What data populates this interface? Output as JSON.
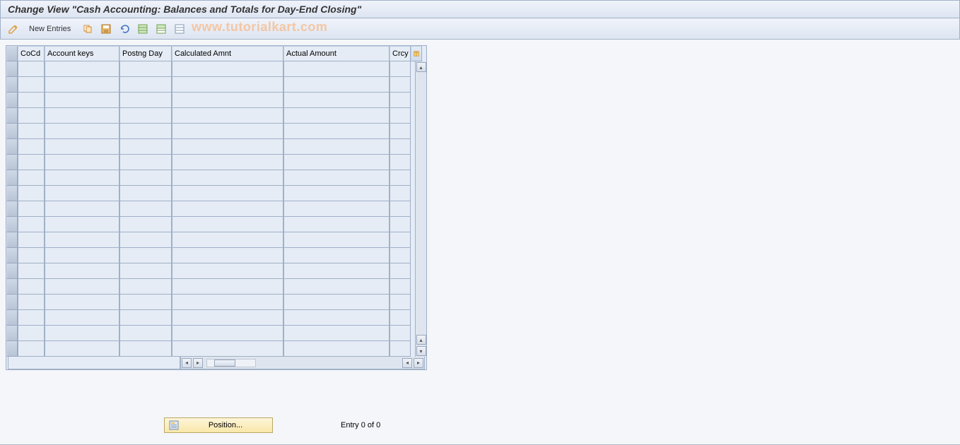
{
  "title": "Change View \"Cash Accounting: Balances and Totals for Day-End Closing\"",
  "toolbar": {
    "new_entries_label": "New Entries"
  },
  "watermark": "www.tutorialkart.com",
  "columns": {
    "cocd": "CoCd",
    "account_keys": "Account keys",
    "postng_day": "Postng Day",
    "calculated_amnt": "Calculated Amnt",
    "actual_amount": "Actual Amount",
    "crcy": "Crcy"
  },
  "rows_count": 19,
  "position_button": "Position...",
  "entry_status": "Entry 0 of 0",
  "icons": {
    "edit": "edit-icon",
    "copy": "copy-icon",
    "save": "save-icon",
    "undo": "undo-icon",
    "select_all": "select-all-icon",
    "select_block": "select-block-icon",
    "deselect": "deselect-icon",
    "config": "table-config-icon",
    "position": "position-icon"
  }
}
